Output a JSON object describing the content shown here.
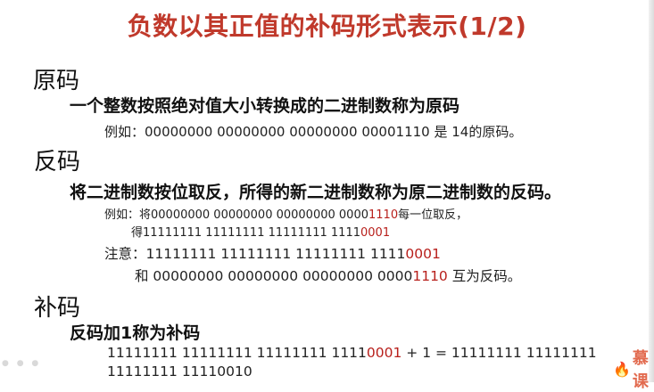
{
  "title": "负数以其正值的补码形式表示(1/2)",
  "sections": {
    "yuanma": {
      "heading": "原码",
      "bold_line": "一个整数按照绝对值大小转换成的二进制数称为原码",
      "example": "例如：00000000 00000000 00000000 00001110 是 14的原码。"
    },
    "fanma": {
      "heading": "反码",
      "bold_line": "将二进制数按位取反，所得的新二进制数称为原二进制数的反码。",
      "example_line1_prefix": "例如：将00000000 00000000 00000000 0000",
      "example_line1_red": "1110",
      "example_line1_suffix": "每一位取反，",
      "example_line2_prefix": "得11111111 11111111 11111111 1111",
      "example_line2_red": "0001",
      "note_prefix": "注意：11111111 11111111 11111111 1111",
      "note_red": "0001",
      "and_prefix": "和 00000000 00000000 00000000 0000",
      "and_red": "1110",
      "and_suffix": " 互为反码。"
    },
    "buma": {
      "heading": "补码",
      "bold_line": "反码加1称为补码",
      "calc_prefix": "11111111 11111111 11111111 1111",
      "calc_red": "0001",
      "calc_suffix": " + 1 = 11111111 11111111",
      "calc_line2": "11111111 11110010"
    }
  },
  "watermark": {
    "icon": "flame-icon",
    "text": "慕课"
  },
  "colors": {
    "title": "#c0392b",
    "highlight": "#b8201c"
  }
}
